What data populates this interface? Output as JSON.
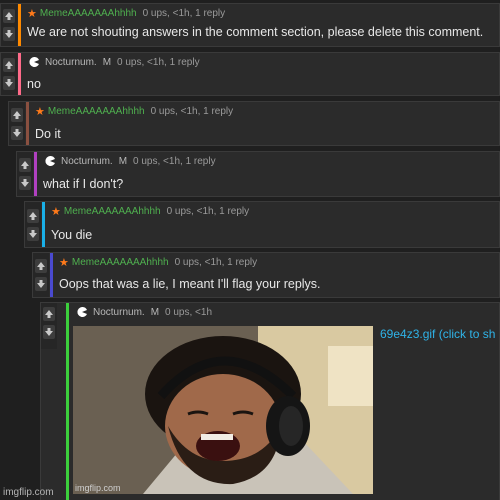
{
  "thread": [
    {
      "user": "MemeAAAAAAAhhhh",
      "user_color": "#4fb04f",
      "badge": "star-icon",
      "meta": "0 ups, <1h, 1 reply",
      "text": "We are not shouting answers in the comment section, please delete this comment.",
      "accent": "#ff8a00"
    },
    {
      "user": "Nocturnum.",
      "mod": "M",
      "badge": "pacman-icon",
      "meta": "0 ups, <1h, 1 reply",
      "text": "no",
      "accent": "#ff6b8a"
    },
    {
      "user": "MemeAAAAAAAhhhh",
      "user_color": "#4fb04f",
      "badge": "star-icon",
      "meta": "0 ups, <1h, 1 reply",
      "text": "Do it",
      "accent": "#8a5040"
    },
    {
      "user": "Nocturnum.",
      "mod": "M",
      "badge": "pacman-icon",
      "meta": "0 ups, <1h, 1 reply",
      "text": "what if I don't?",
      "accent": "#b040c0"
    },
    {
      "user": "MemeAAAAAAAhhhh",
      "user_color": "#4fb04f",
      "badge": "star-icon",
      "meta": "0 ups, <1h, 1 reply",
      "text": "You die",
      "accent": "#1ab0e8"
    },
    {
      "user": "MemeAAAAAAAhhhh",
      "user_color": "#4fb04f",
      "badge": "star-icon",
      "meta": "0 ups, <1h, 1 reply",
      "text": "Oops that was a lie, I meant I'll flag your replys.",
      "accent": "#4a4ad0"
    },
    {
      "user": "Nocturnum.",
      "mod": "M",
      "badge": "pacman-icon",
      "meta": "0 ups, <1h",
      "text": "",
      "accent": "#3ccf3c"
    }
  ],
  "gif": {
    "link_text": "69e4z3.gif (click to sh",
    "watermark": "imgflip.com"
  },
  "site_watermark": "imgflip.com"
}
